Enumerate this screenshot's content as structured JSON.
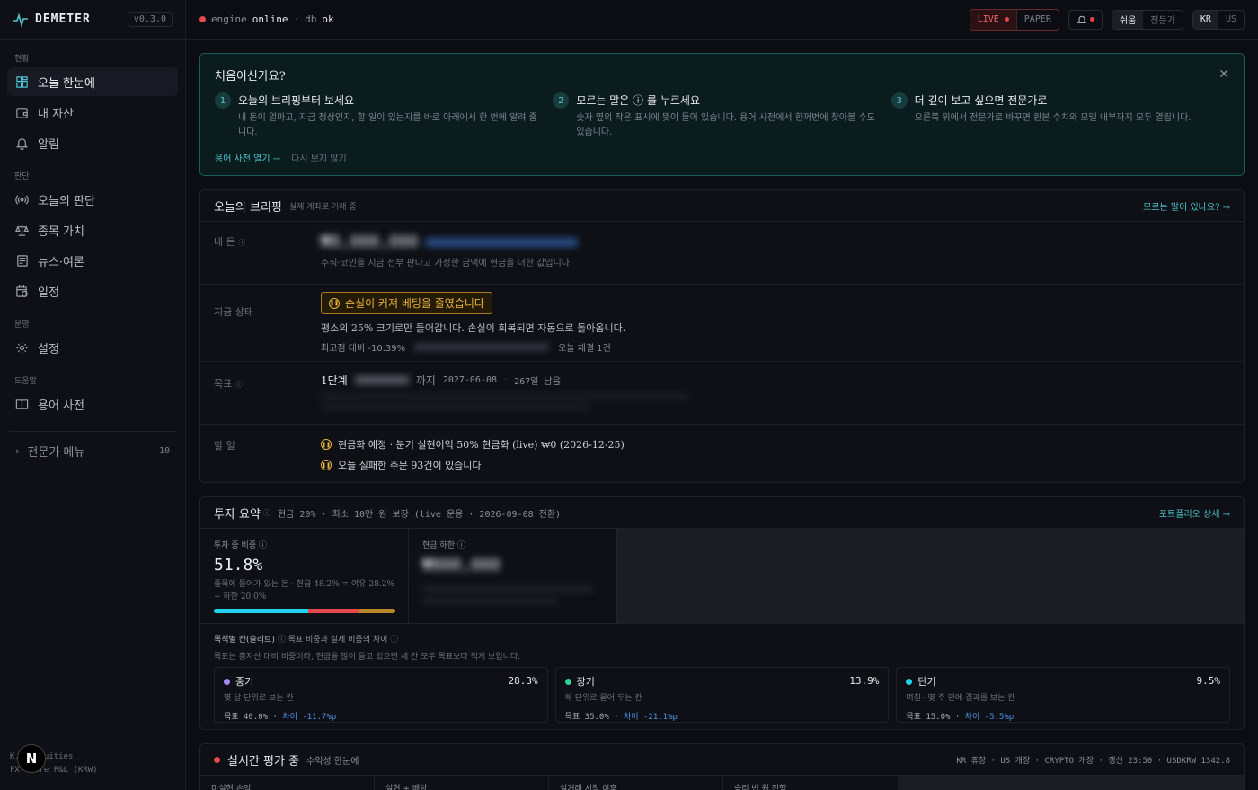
{
  "sidebar": {
    "brand": "DEMETER",
    "version": "v0.3.0",
    "sections": [
      {
        "title": "현황",
        "items": [
          {
            "label": "오늘 한눈에",
            "icon": "dashboard-grid-icon",
            "active": true
          },
          {
            "label": "내 자산",
            "icon": "wallet-icon"
          },
          {
            "label": "알림",
            "icon": "bell-icon"
          }
        ]
      },
      {
        "title": "판단",
        "items": [
          {
            "label": "오늘의 판단",
            "icon": "broadcast-icon"
          },
          {
            "label": "종목 가치",
            "icon": "scale-icon"
          },
          {
            "label": "뉴스·여론",
            "icon": "newspaper-icon"
          },
          {
            "label": "일정",
            "icon": "calendar-clock-icon"
          }
        ]
      },
      {
        "title": "운영",
        "items": [
          {
            "label": "설정",
            "icon": "gear-icon"
          }
        ]
      },
      {
        "title": "도움말",
        "items": [
          {
            "label": "용어 사전",
            "icon": "book-icon"
          }
        ]
      }
    ],
    "expert_menu": {
      "label": "전문가 메뉴",
      "count": "10"
    },
    "footer_line1": "K... equities",
    "footer_line2": "FX-aware P&L (KRW)",
    "badge": "N"
  },
  "topbar": {
    "engine_label": "engine",
    "engine_state": "online",
    "db_label": "db",
    "db_state": "ok",
    "live": "LIVE",
    "paper": "PAPER",
    "mode_easy": "쉬움",
    "mode_expert": "전문가",
    "market_kr": "KR",
    "market_us": "US"
  },
  "onboarding": {
    "title": "처음이신가요?",
    "steps": [
      {
        "num": "1",
        "title": "오늘의 브리핑부터 보세요",
        "desc": "내 돈이 얼마고, 지금 정상인지, 할 일이 있는지를 바로 아래에서 한 번에 알려 줍니다."
      },
      {
        "num": "2",
        "title": "모르는 말은 ⓘ 를 누르세요",
        "desc": "숫자 옆의 작은 표시에 뜻이 들어 있습니다. 용어 사전에서 한꺼번에 찾아볼 수도 있습니다."
      },
      {
        "num": "3",
        "title": "더 깊이 보고 싶으면 전문가로",
        "desc": "오른쪽 위에서 전문가로 바꾸면 원본 수치와 모델 내부까지 모두 열립니다."
      }
    ],
    "link_glossary": "용어 사전 열기 →",
    "link_dismiss": "다시 보지 않기"
  },
  "briefing": {
    "title": "오늘의 브리핑",
    "subtitle": "실제 계좌로 거래 중",
    "help_link": "모르는 말이 있나요? →",
    "money_label": "내 돈",
    "money_value": "₩8,000,000",
    "money_desc": "주식·코인을 지금 전부 판다고 가정한 금액에 현금을 더한 값입니다.",
    "status_label": "지금 상태",
    "status_alert": "손실이 커져 베팅을 줄였습니다",
    "status_desc": "평소의 25% 크기로만 들어갑니다. 손실이 회복되면 자동으로 돌아옵니다.",
    "drawdown": "최고점 대비 -10.39%",
    "fills": "오늘 체결 1건",
    "goal_label": "목표",
    "goal_stage": "1단계",
    "goal_until": "까지",
    "goal_date": "2027-06-08",
    "goal_remaining": "267일 남음",
    "todo_label": "할 일",
    "todos": [
      "현금화 예정 · 분기 실현이익 50% 현금화 (live) ₩0 (2026-12-25)",
      "오늘 실패한 주문 93건이 있습니다"
    ]
  },
  "summary": {
    "title": "투자 요약",
    "meta": "현금 20% · 최소 10만 원 보장 (live 운용 · 2026-09-08 전환)",
    "link": "포트폴리오 상세 →",
    "invested_label": "투자 중 비중",
    "invested_value": "51.8%",
    "invested_desc": "종목에 들어가 있는 돈 · 현금 48.2% = 여유 28.2% + 하한 20.0%",
    "invested_fraction": 0.518,
    "cash_label": "현금 하한",
    "cash_value": "₩800,000",
    "slots_title": "목적별 칸(슬리브)",
    "slots_meta": "목표 비중과 실제 비중의 차이",
    "slots_desc": "목표는 총자산 대비 비중이라, 현금을 많이 들고 있으면 세 칸 모두 목표보다 적게 보입니다.",
    "sleeves": [
      {
        "name": "중기",
        "pct": "28.3%",
        "desc": "몇 달 단위로 보는 칸",
        "target": "목표 40.0%",
        "diff": "차이 -11.7%p",
        "color": "#a78bfa"
      },
      {
        "name": "장기",
        "pct": "13.9%",
        "desc": "해 단위로 묻어 두는 칸",
        "target": "목표 35.0%",
        "diff": "차이 -21.1%p",
        "color": "#34d399"
      },
      {
        "name": "단기",
        "pct": "9.5%",
        "desc": "며칠~몇 주 안에 결과를 보는 칸",
        "target": "목표 15.0%",
        "diff": "차이 -5.5%p",
        "color": "#22d3ee"
      }
    ]
  },
  "realtime": {
    "title": "실시간 평가 중",
    "subtitle": "수익성 한눈에",
    "markets": "KR 휴장 · US 개장 · CRYPTO 개장 · 갱신 23:50 · USDKRW 1342.8",
    "cols": [
      "미실현 손익",
      "실현 + 배당",
      "실거래 시작 이후",
      "승리 번 원 진행"
    ]
  }
}
